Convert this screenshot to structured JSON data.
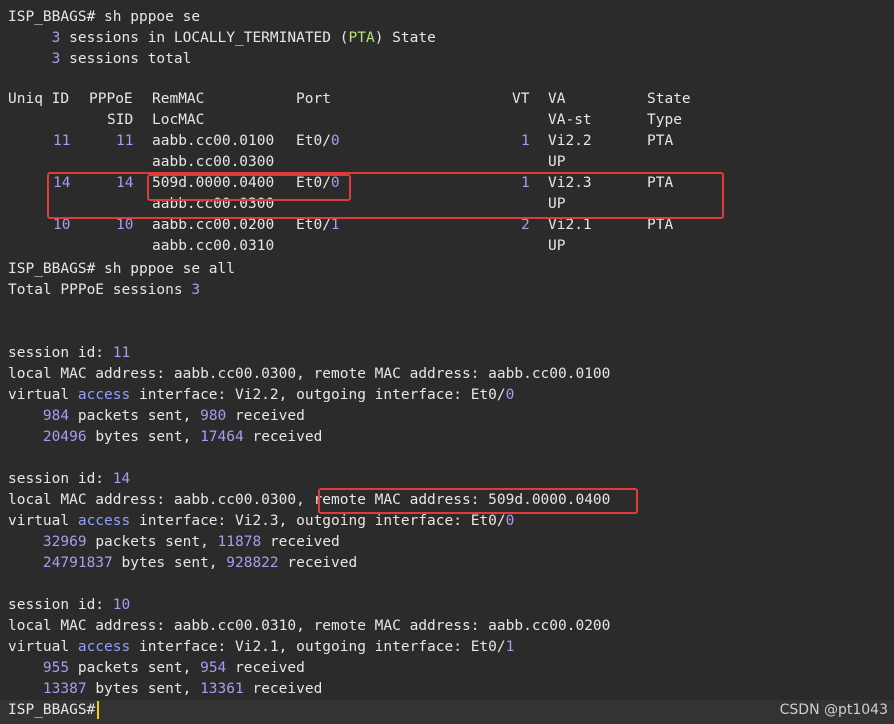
{
  "prompt": "ISP_BBAGS#",
  "cmd1": {
    "text": "sh pppoe se",
    "sum1": {
      "n": "3",
      "a": "sessions in LOCALLY_TERMINATED",
      "p1": "(",
      "pta": "PTA",
      "p2": ")",
      "b": "State"
    },
    "sum2": {
      "n": "3",
      "a": "sessions total"
    },
    "headers": {
      "uniq_id": "Uniq ID",
      "pppoe": "PPPoE",
      "sid": "SID",
      "remmac": "RemMAC",
      "locmac": "LocMAC",
      "port": "Port",
      "vt": "VT",
      "va": "VA",
      "va_st": "VA-st",
      "state": "State",
      "type": "Type"
    },
    "rows": [
      {
        "uniq": "11",
        "sid": "11",
        "remmac": "aabb.cc00.0100",
        "port_a": "Et0/",
        "port_b": "0",
        "vt": "1",
        "va": "Vi2.2",
        "state": "PTA",
        "locmac": "aabb.cc00.0300",
        "va_st": "UP"
      },
      {
        "uniq": "14",
        "sid": "14",
        "remmac": "509d.0000.0400",
        "port_a": "Et0/",
        "port_b": "0",
        "vt": "1",
        "va": "Vi2.3",
        "state": "PTA",
        "locmac": "aabb.cc00.0300",
        "va_st": "UP"
      },
      {
        "uniq": "10",
        "sid": "10",
        "remmac": "aabb.cc00.0200",
        "port_a": "Et0/",
        "port_b": "1",
        "vt": "2",
        "va": "Vi2.1",
        "state": "PTA",
        "locmac": "aabb.cc00.0310",
        "va_st": "UP"
      }
    ]
  },
  "cmd2": {
    "text": "sh pppoe se all",
    "total_label": "Total PPPoE sessions",
    "total": "3"
  },
  "sessions": [
    {
      "sid_label": "session id:",
      "sid": "11",
      "local_label": "local MAC address:",
      "local": "aabb.cc00.0300,",
      "remote_label": "remote MAC address:",
      "remote": "aabb.cc00.0100",
      "v1": "virtual",
      "v2": "access",
      "v3": "interface: Vi2.2, outgoing interface: Et0/",
      "v4": "0",
      "pkts_sent": "984",
      "pkts_sent_label": "packets sent,",
      "pkts_recv": "980",
      "recv_label": "received",
      "bytes_sent": "20496",
      "bytes_sent_label": "bytes sent,",
      "bytes_recv": "17464"
    },
    {
      "sid_label": "session id:",
      "sid": "14",
      "local_label": "local MAC address:",
      "local": "aabb.cc00.0300,",
      "remote_label": "remote MAC address:",
      "remote": "509d.0000.0400",
      "v1": "virtual",
      "v2": "access",
      "v3": "interface: Vi2.3, outgoing interface: Et0/",
      "v4": "0",
      "pkts_sent": "32969",
      "pkts_sent_label": "packets sent,",
      "pkts_recv": "11878",
      "recv_label": "received",
      "bytes_sent": "24791837",
      "bytes_sent_label": "bytes sent,",
      "bytes_recv": "928822"
    },
    {
      "sid_label": "session id:",
      "sid": "10",
      "local_label": "local MAC address:",
      "local": "aabb.cc00.0310,",
      "remote_label": "remote MAC address:",
      "remote": "aabb.cc00.0200",
      "v1": "virtual",
      "v2": "access",
      "v3": "interface: Vi2.1, outgoing interface: Et0/",
      "v4": "1",
      "pkts_sent": "955",
      "pkts_sent_label": "packets sent,",
      "pkts_recv": "954",
      "recv_label": "received",
      "bytes_sent": "13387",
      "bytes_sent_label": "bytes sent,",
      "bytes_recv": "13361"
    }
  ],
  "watermark": "CSDN @pt1043",
  "colors": {
    "background": "#2b2b2b",
    "text": "#e6e6e6",
    "number": "#a99cf0",
    "keyword": "#8fa0ff",
    "pta": "#b5e07a",
    "highlight": "#e03a3a",
    "cursor": "#f0d000"
  }
}
